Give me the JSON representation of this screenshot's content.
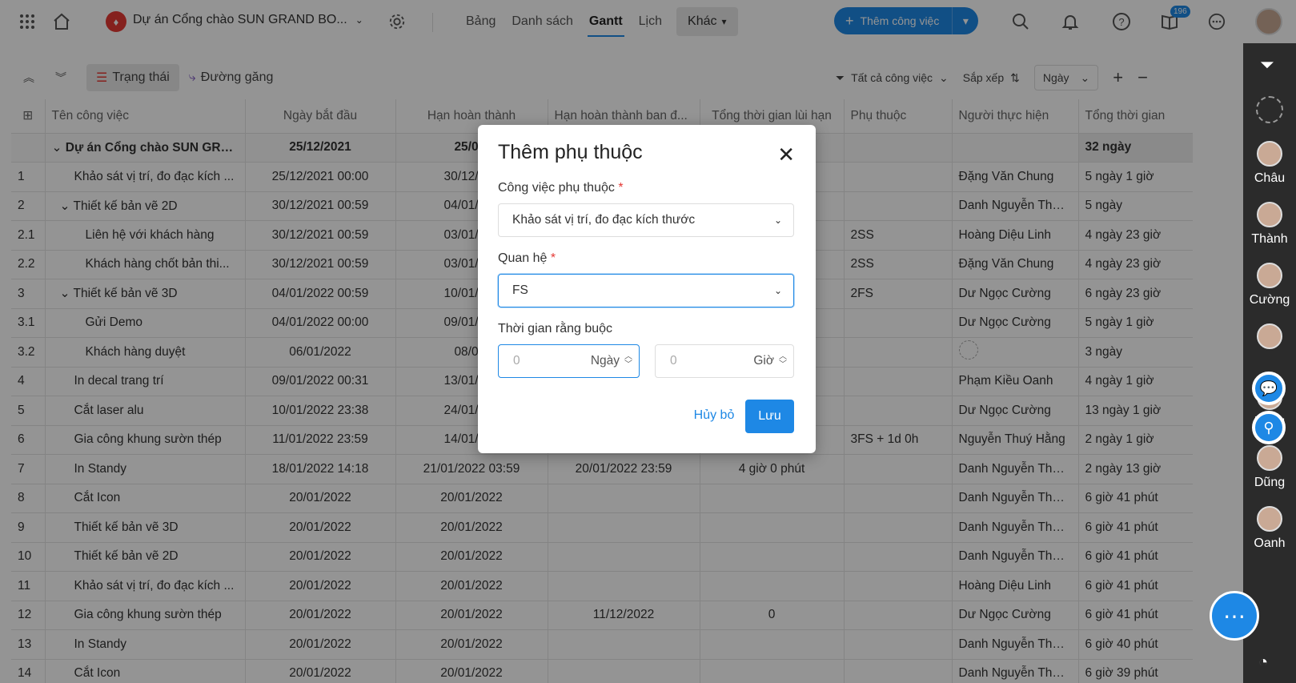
{
  "topbar": {
    "project_name": "Dự án Cổng chào SUN GRAND BO...",
    "tabs": [
      {
        "label": "Bảng"
      },
      {
        "label": "Danh sách"
      },
      {
        "label": "Gantt"
      },
      {
        "label": "Lịch"
      }
    ],
    "more_label": "Khác",
    "add_task_label": "Thêm công việc",
    "notification_badge": "196",
    "active_tab": "Gantt",
    "accent_color": "#1e88e5"
  },
  "toolbar": {
    "status_label": "Trạng thái",
    "critical_path_label": "Đường găng",
    "filter_label": "Tất cả công việc",
    "sort_label": "Sắp xếp",
    "scale_label": "Ngày"
  },
  "table": {
    "headers": [
      "Tên công việc",
      "Ngày bắt đầu",
      "Hạn hoàn thành",
      "Hạn hoàn thành ban đ...",
      "Tổng thời gian lùi hạn",
      "Phụ thuộc",
      "Người thực hiện",
      "Tổng thời gian"
    ],
    "parent": {
      "name": "Dự án Cổng chào SUN GRA...",
      "start": "25/12/2021",
      "due": "25/01/",
      "total": "32 ngày"
    },
    "rows": [
      {
        "no": "1",
        "name": "Khảo sát vị trí, đo đạc kích ...",
        "start": "25/12/2021 00:00",
        "due": "30/12/202",
        "orig": "",
        "delay": "",
        "dep": "",
        "owner": "Đặng Văn Chung",
        "total": "5 ngày 1 giờ"
      },
      {
        "no": "2",
        "name": "Thiết kế bản vẽ 2D",
        "start": "30/12/2021 00:59",
        "due": "04/01/202",
        "orig": "",
        "delay": "",
        "dep": "",
        "owner": "Danh Nguyễn Thành",
        "total": "5 ngày"
      },
      {
        "no": "2.1",
        "name": "Liên hệ với khách hàng",
        "start": "30/12/2021 00:59",
        "due": "03/01/202",
        "orig": "",
        "delay": "",
        "dep": "2SS",
        "owner": "Hoàng Diệu Linh",
        "total": "4 ngày 23 giờ"
      },
      {
        "no": "2.2",
        "name": "Khách hàng chốt bản thi...",
        "start": "30/12/2021 00:59",
        "due": "03/01/202",
        "orig": "",
        "delay": "",
        "dep": "2SS",
        "owner": "Đặng Văn Chung",
        "total": "4 ngày 23 giờ"
      },
      {
        "no": "3",
        "name": "Thiết kế bản vẽ 3D",
        "start": "04/01/2022 00:59",
        "due": "10/01/202",
        "orig": "",
        "delay": "",
        "dep": "2FS",
        "owner": "Dư Ngọc Cường",
        "total": "6 ngày 23 giờ"
      },
      {
        "no": "3.1",
        "name": "Gửi Demo",
        "start": "04/01/2022 00:00",
        "due": "09/01/202",
        "orig": "",
        "delay": "",
        "dep": "",
        "owner": "Dư Ngọc Cường",
        "total": "5 ngày 1 giờ"
      },
      {
        "no": "3.2",
        "name": "Khách hàng duyệt",
        "start": "06/01/2022",
        "due": "08/01/",
        "orig": "",
        "delay": "",
        "dep": "",
        "owner": "",
        "total": "3 ngày"
      },
      {
        "no": "4",
        "name": "In decal trang trí",
        "start": "09/01/2022 00:31",
        "due": "13/01/202",
        "orig": "",
        "delay": "",
        "dep": "",
        "owner": "Phạm Kiều Oanh",
        "total": "4 ngày 1 giờ"
      },
      {
        "no": "5",
        "name": "Cắt laser alu",
        "start": "10/01/2022 23:38",
        "due": "24/01/202",
        "orig": "",
        "delay": "",
        "dep": "",
        "owner": "Dư Ngọc Cường",
        "total": "13 ngày 1 giờ"
      },
      {
        "no": "6",
        "name": "Gia công khung sườn thép",
        "start": "11/01/2022 23:59",
        "due": "14/01/202",
        "orig": "",
        "delay": "",
        "dep": "3FS + 1d 0h",
        "owner": "Nguyễn Thuý Hằng",
        "total": "2 ngày 1 giờ"
      },
      {
        "no": "7",
        "name": "In Standy",
        "start": "18/01/2022 14:18",
        "due": "21/01/2022 03:59",
        "orig": "20/01/2022 23:59",
        "delay": "4 giờ 0 phút",
        "dep": "",
        "owner": "Danh Nguyễn Thành",
        "total": "2 ngày 13 giờ"
      },
      {
        "no": "8",
        "name": "Cắt Icon",
        "start": "20/01/2022",
        "due": "20/01/2022",
        "orig": "",
        "delay": "",
        "dep": "",
        "owner": "Danh Nguyễn Thành",
        "total": "6 giờ 41 phút"
      },
      {
        "no": "9",
        "name": "Thiết kế bản vẽ 3D",
        "start": "20/01/2022",
        "due": "20/01/2022",
        "orig": "",
        "delay": "",
        "dep": "",
        "owner": "Danh Nguyễn Thành",
        "total": "6 giờ 41 phút"
      },
      {
        "no": "10",
        "name": "Thiết kế bản vẽ 2D",
        "start": "20/01/2022",
        "due": "20/01/2022",
        "orig": "",
        "delay": "",
        "dep": "",
        "owner": "Danh Nguyễn Thành",
        "total": "6 giờ 41 phút"
      },
      {
        "no": "11",
        "name": "Khảo sát vị trí, đo đạc kích ...",
        "start": "20/01/2022",
        "due": "20/01/2022",
        "orig": "",
        "delay": "",
        "dep": "",
        "owner": "Hoàng Diệu Linh",
        "total": "6 giờ 41 phút"
      },
      {
        "no": "12",
        "name": "Gia công khung sườn thép",
        "start": "20/01/2022",
        "due": "20/01/2022",
        "orig": "11/12/2022",
        "delay": "0",
        "dep": "",
        "owner": "Dư Ngọc Cường",
        "total": "6 giờ 41 phút"
      },
      {
        "no": "13",
        "name": "In Standy",
        "start": "20/01/2022",
        "due": "20/01/2022",
        "orig": "",
        "delay": "",
        "dep": "",
        "owner": "Danh Nguyễn Thành",
        "total": "6 giờ 40 phút"
      },
      {
        "no": "14",
        "name": "Cắt Icon",
        "start": "20/01/2022",
        "due": "20/01/2022",
        "orig": "",
        "delay": "",
        "dep": "",
        "owner": "Danh Nguyễn Thành",
        "total": "6 giờ 39 phút"
      }
    ]
  },
  "sidebar": {
    "members": [
      {
        "label": "Châu"
      },
      {
        "label": "Thành"
      },
      {
        "label": "Cường"
      },
      {
        "label": ""
      },
      {
        "label": "Hằng"
      },
      {
        "label": "Dũng"
      },
      {
        "label": "Oanh"
      }
    ]
  },
  "modal": {
    "title": "Thêm phụ thuộc",
    "dependency_label": "Công việc phụ thuộc",
    "dependency_value": "Khảo sát vị trí, đo đạc kích thước",
    "relation_label": "Quan hệ",
    "relation_value": "FS",
    "constraint_label": "Thời gian rằng buộc",
    "days_value": "0",
    "days_unit": "Ngày",
    "hours_value": "0",
    "hours_unit": "Giờ",
    "cancel_label": "Hủy bỏ",
    "save_label": "Lưu",
    "required_mark": "*"
  }
}
